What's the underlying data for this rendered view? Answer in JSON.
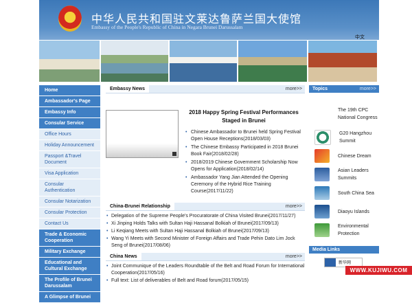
{
  "header": {
    "title_cn": "中华人民共和国驻文莱达鲁萨兰国大使馆",
    "title_en": "Embassy of the People's Republic of China in Negara Brunei Darussalam",
    "language_link": "中文"
  },
  "leftnav": {
    "items": [
      {
        "label": "Home",
        "type": "main"
      },
      {
        "label": "Ambassador's Page",
        "type": "main"
      },
      {
        "label": "Embassy Info",
        "type": "main"
      },
      {
        "label": "Consular Service",
        "type": "main"
      },
      {
        "label": "Office Hours",
        "type": "sub"
      },
      {
        "label": "Holiday Announcement",
        "type": "sub"
      },
      {
        "label": "Passport &Travel Document",
        "type": "sub"
      },
      {
        "label": "Visa Application",
        "type": "sub"
      },
      {
        "label": "Consular Authentication",
        "type": "sub"
      },
      {
        "label": "Consular Notarization",
        "type": "sub"
      },
      {
        "label": "Consular Protection",
        "type": "sub"
      },
      {
        "label": "Contact Us",
        "type": "sub"
      },
      {
        "label": "Trade & Economic Cooperation",
        "type": "main"
      },
      {
        "label": "Military Exchange",
        "type": "main"
      },
      {
        "label": "Educational and Cultural Exchange",
        "type": "main"
      },
      {
        "label": "The Profile of Brunei Darussalam",
        "type": "main"
      },
      {
        "label": "A Glimpse of Brunei",
        "type": "main"
      }
    ]
  },
  "embassy_news": {
    "heading": "Embassy News",
    "more": "more>>",
    "feature_title": "2018 Happy Spring Festival Performances Staged in Brunei",
    "items": [
      "Chinese Ambassador to Brunei held Spring Festival Open House Receptions(2018/03/03)",
      "The Chinese Embassy Participated in 2018 Brunei Book Fair(2018/02/28)",
      "2018/2019 Chinese Government Scholarship Now Opens for Application(2018/02/14)",
      "Ambassador Yang Jian Attended the Opening Ceremony of the Hybrid Rice Training Course(2017/11/22)"
    ]
  },
  "relationship": {
    "heading": "China-Brunei Relationship",
    "more": "more>>",
    "items": [
      "Delegation of the Supreme People's Procuratorate of China Visited Brunei(2017/11/27)",
      "Xi Jinping Holds Talks with Sultan Haji Hassanal Bolkiah of Brunei(2017/09/13)",
      "Li Keqiang Meets with Sultan Haji Hassanal Bolkiah of Brunei(2017/09/13)",
      "Wang Yi Meets with Second Minister of Foreign Affairs and Trade Pehin Dato Lim Jock Seng of Brunei(2017/08/06)"
    ]
  },
  "china_news": {
    "heading": "China News",
    "more": "more>>",
    "items": [
      "Joint Communique of the Leaders Roundtable of the Belt and Road Forum for International Cooperation(2017/05/16)",
      "Full text: List of deliverables of Belt and Road forum(2017/05/15)"
    ]
  },
  "topics": {
    "heading": "Topics",
    "more": "more>>",
    "items": [
      {
        "label": "The 19th CPC National Congress",
        "icon": "none"
      },
      {
        "label": "G20 Hangzhou Summit",
        "icon": "g20-icon"
      },
      {
        "label": "Chinese Dream",
        "icon": "chinese-dream-icon"
      },
      {
        "label": "Asian Leaders Summits",
        "icon": "asian-summits-icon"
      },
      {
        "label": "South China Sea",
        "icon": "south-china-sea-icon"
      },
      {
        "label": "Diaoyu Islands",
        "icon": "diaoyu-islands-icon"
      },
      {
        "label": "Environmental Protection",
        "icon": "environment-icon"
      }
    ]
  },
  "media_links": {
    "heading": "Media Links",
    "logo_text": "新华网"
  },
  "watermark": "WWW.KUJIWU.COM",
  "colors": {
    "nav_blue": "#3f7fc4",
    "nav_sub_bg": "#e3edf7",
    "link_blue": "#2d62a8"
  }
}
